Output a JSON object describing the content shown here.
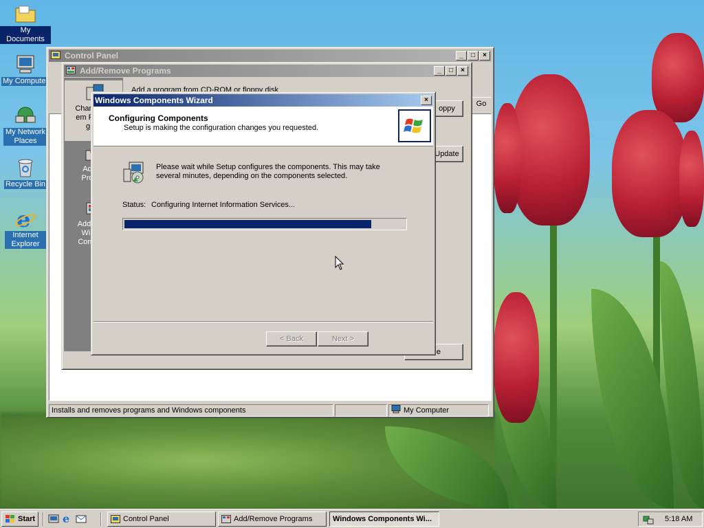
{
  "desktop": {
    "icons": [
      {
        "label": "My Documents",
        "icon": "my-documents-folder-icon"
      },
      {
        "label": "My Computer",
        "icon": "my-computer-icon"
      },
      {
        "label": "My Network Places",
        "icon": "network-places-icon"
      },
      {
        "label": "Recycle Bin",
        "icon": "recycle-bin-icon"
      },
      {
        "label": "Internet Explorer",
        "icon": "internet-explorer-icon"
      }
    ]
  },
  "control_panel": {
    "title": "Control Panel",
    "go_label": "Go",
    "status_text": "Installs and removes programs and Windows components",
    "status_location": "My Computer"
  },
  "add_remove": {
    "title": "Add/Remove Programs",
    "cdrom_text": "Add a program from CD-ROM or floppy disk",
    "floppy_button_label": "oppy",
    "update_button_label": "Update",
    "close_button_label": "e",
    "sidebar": [
      {
        "label": "Chan Rem Prog"
      },
      {
        "label": "Add Prog"
      },
      {
        "label": "Add/R Win Comp"
      }
    ],
    "left_fragments": [
      "A",
      "A",
      "I",
      "W",
      "W",
      "W"
    ]
  },
  "wizard": {
    "title": "Windows Components Wizard",
    "heading": "Configuring Components",
    "subheading": "Setup is making the configuration changes you requested.",
    "message": "Please wait while Setup configures the components. This may take several minutes, depending on the components selected.",
    "status_label": "Status:",
    "status_value": "Configuring Internet Information Services...",
    "progress": 0.88,
    "back_label": "< Back",
    "next_label": "Next >"
  },
  "taskbar": {
    "start_label": "Start",
    "tasks": [
      {
        "label": "Control Panel",
        "active": false
      },
      {
        "label": "Add/Remove Programs",
        "active": false
      },
      {
        "label": "Windows Components Wi...",
        "active": true
      }
    ],
    "clock": "5:18 AM"
  },
  "colors": {
    "title_active": "#0a246a",
    "title_inactive": "#808080",
    "face": "#d4d0c8",
    "progress_fill": "#0a246a"
  }
}
